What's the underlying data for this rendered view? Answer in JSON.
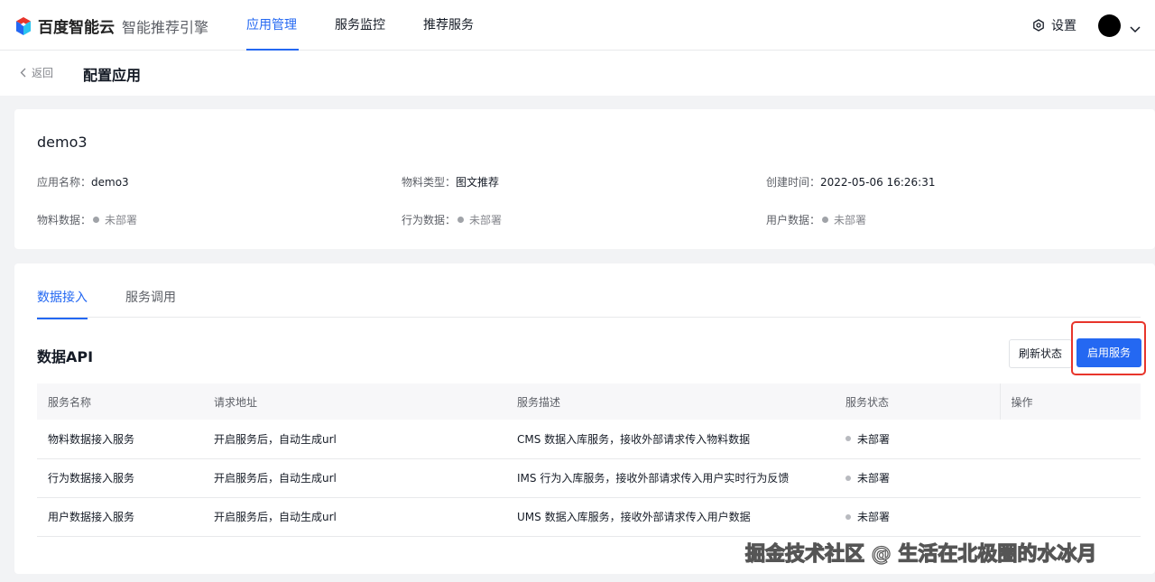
{
  "header": {
    "brand": "百度智能云",
    "product": "智能推荐引擎",
    "nav": [
      "应用管理",
      "服务监控",
      "推荐服务"
    ],
    "settings_label": "设置"
  },
  "subheader": {
    "back_label": "返回",
    "title": "配置应用"
  },
  "app": {
    "name": "demo3",
    "fields": {
      "app_name_label": "应用名称：",
      "app_name_value": "demo3",
      "material_type_label": "物料类型：",
      "material_type_value": "图文推荐",
      "created_label": "创建时间：",
      "created_value": "2022-05-06 16:26:31",
      "material_data_label": "物料数据：",
      "material_data_value": "未部署",
      "behavior_data_label": "行为数据：",
      "behavior_data_value": "未部署",
      "user_data_label": "用户数据：",
      "user_data_value": "未部署"
    }
  },
  "tabs": [
    "数据接入",
    "服务调用"
  ],
  "section": {
    "title": "数据API",
    "refresh_label": "刷新状态",
    "enable_label": "启用服务"
  },
  "table": {
    "headers": [
      "服务名称",
      "请求地址",
      "服务描述",
      "服务状态",
      "操作"
    ],
    "rows": [
      [
        "物料数据接入服务",
        "开启服务后，自动生成url",
        "CMS 数据入库服务，接收外部请求传入物料数据",
        "未部署"
      ],
      [
        "行为数据接入服务",
        "开启服务后，自动生成url",
        "IMS 行为入库服务，接收外部请求传入用户实时行为反馈",
        "未部署"
      ],
      [
        "用户数据接入服务",
        "开启服务后，自动生成url",
        "UMS 数据入库服务，接收外部请求传入用户数据",
        "未部署"
      ]
    ]
  },
  "watermark": "掘金技术社区 @ 生活在北极圈的水冰月",
  "colors": {
    "accent": "#2468f2",
    "highlight": "#e8352b"
  },
  "icons": [
    "baidu-cloud-logo-icon",
    "chevron-left-icon",
    "gear-icon",
    "chevron-down-icon"
  ]
}
